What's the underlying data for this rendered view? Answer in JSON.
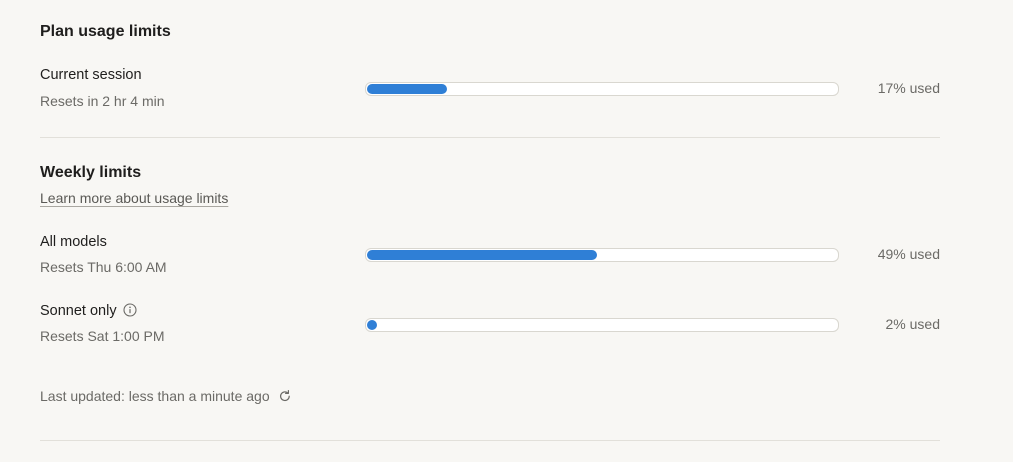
{
  "plan": {
    "title": "Plan usage limits",
    "current_session": {
      "label": "Current session",
      "resets": "Resets in 2 hr 4 min",
      "used_fraction": 0.17,
      "used_text": "17% used"
    }
  },
  "weekly": {
    "title": "Weekly limits",
    "learn_more": "Learn more about usage limits",
    "all_models": {
      "label": "All models",
      "resets": "Resets Thu 6:00 AM",
      "used_fraction": 0.49,
      "used_text": "49% used"
    },
    "sonnet_only": {
      "label": "Sonnet only",
      "resets": "Resets Sat 1:00 PM",
      "used_fraction": 0.02,
      "used_text": "2% used"
    }
  },
  "footer": {
    "last_updated": "Last updated: less than a minute ago"
  },
  "icons": {
    "info": "info-icon",
    "refresh": "refresh-icon"
  },
  "colors": {
    "bar_fill": "#2f7fd6",
    "background": "#f8f7f4"
  }
}
